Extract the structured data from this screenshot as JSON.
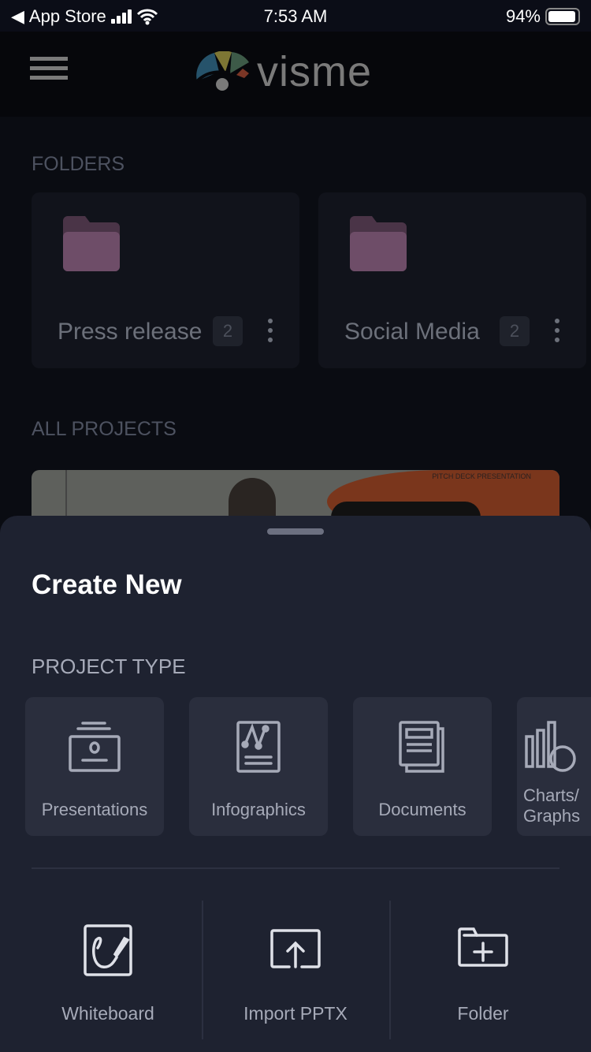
{
  "status_bar": {
    "back_label": "App Store",
    "time": "7:53 AM",
    "battery": "94%",
    "battery_level": 94
  },
  "header": {
    "logo_text": "visme"
  },
  "folders": {
    "section_title": "FOLDERS",
    "items": [
      {
        "name": "Press release",
        "count": "2"
      },
      {
        "name": "Social Media",
        "count": "2"
      }
    ]
  },
  "projects": {
    "section_title": "ALL PROJECTS",
    "thumbnail_caption": "PITCH DECK PRESENTATION"
  },
  "sheet": {
    "title": "Create New",
    "project_type_label": "PROJECT TYPE",
    "types": [
      {
        "label": "Presentations",
        "icon": "presentation-icon"
      },
      {
        "label": "Infographics",
        "icon": "infographic-icon"
      },
      {
        "label": "Documents",
        "icon": "document-icon"
      },
      {
        "label": "Charts/Graphs",
        "icon": "chart-icon"
      }
    ],
    "actions": [
      {
        "label": "Whiteboard",
        "icon": "whiteboard-icon"
      },
      {
        "label": "Import PPTX",
        "icon": "upload-icon"
      },
      {
        "label": "Folder",
        "icon": "folder-plus-icon"
      }
    ]
  },
  "colors": {
    "sheet_bg": "#1e2230",
    "card_bg": "#2a2e3d",
    "folder_icon": "#6e4d68"
  }
}
